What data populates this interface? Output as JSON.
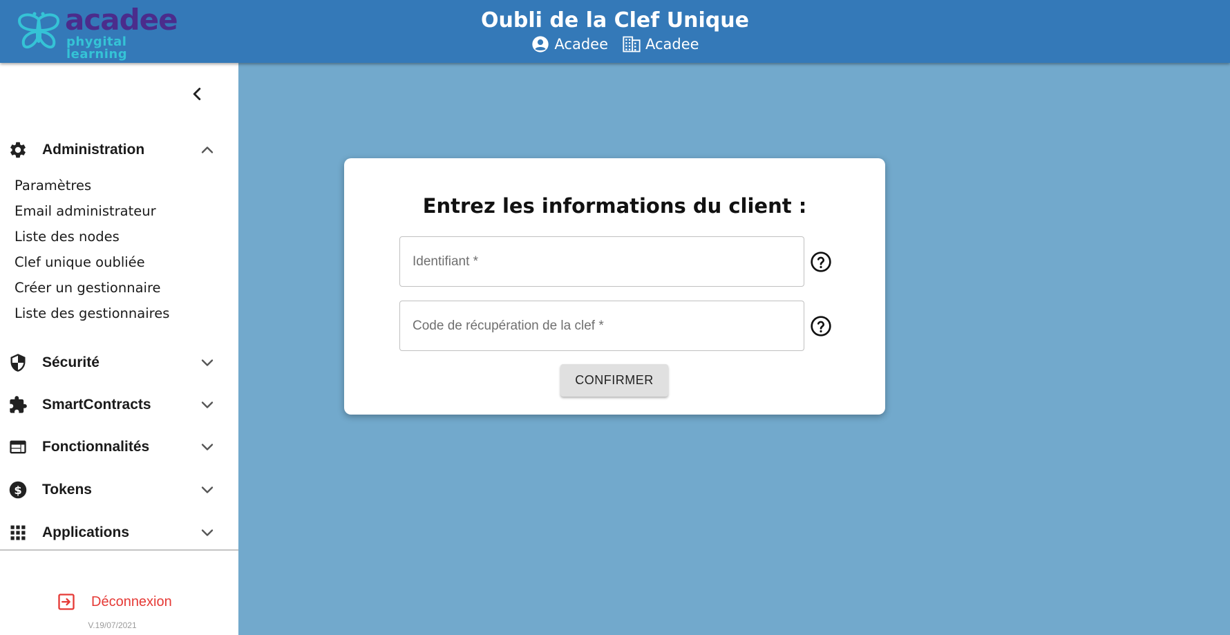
{
  "brand": {
    "name": "acadee",
    "tagline": "phygital learning",
    "primary_color": "#3479b8",
    "logo_purple": "#4b2c8c",
    "logo_cyan": "#35c3d6"
  },
  "header": {
    "title": "Oubli de la Clef Unique",
    "user_icon": "account-circle-icon",
    "user_name": "Acadee",
    "org_icon": "building-icon",
    "org_name": "Acadee"
  },
  "sidebar": {
    "collapse_icon": "chevron-left-icon",
    "sections": [
      {
        "icon": "gear-icon",
        "label": "Administration",
        "expanded": true,
        "chevron": "chevron-up-icon",
        "items": [
          "Paramètres",
          "Email administrateur",
          "Liste des nodes",
          "Clef unique oubliée",
          "Créer un gestionnaire",
          "Liste des gestionnaires"
        ]
      },
      {
        "icon": "shield-icon",
        "label": "Sécurité",
        "expanded": false,
        "chevron": "chevron-down-icon"
      },
      {
        "icon": "puzzle-icon",
        "label": "SmartContracts",
        "expanded": false,
        "chevron": "chevron-down-icon"
      },
      {
        "icon": "web-icon",
        "label": "Fonctionnalités",
        "expanded": false,
        "chevron": "chevron-down-icon"
      },
      {
        "icon": "dollar-coin-icon",
        "label": "Tokens",
        "expanded": false,
        "chevron": "chevron-down-icon"
      },
      {
        "icon": "apps-grid-icon",
        "label": "Applications",
        "expanded": false,
        "chevron": "chevron-down-icon"
      }
    ],
    "logout_label": "Déconnexion",
    "logout_icon": "logout-icon",
    "logout_color": "#e53935",
    "version": "V.19/07/2021"
  },
  "form": {
    "title": "Entrez les informations du client :",
    "identifier_placeholder": "Identifiant *",
    "identifier_value": "",
    "recovery_placeholder": "Code de récupération de la clef *",
    "recovery_value": "",
    "help_icon": "help-circle-icon",
    "confirm_label": "CONFIRMER"
  },
  "content_bg": "#72a9cc"
}
